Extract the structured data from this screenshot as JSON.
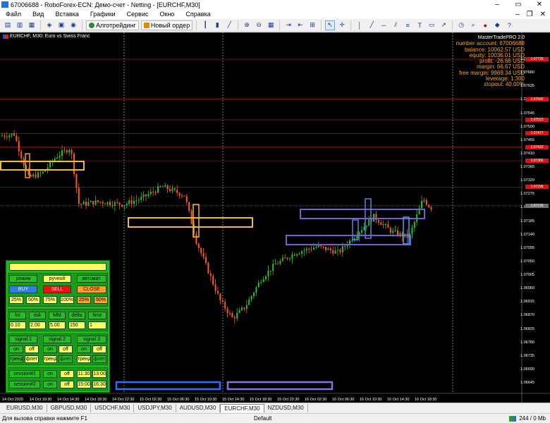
{
  "window": {
    "title": "67006688 - RoboForex-ECN: Демо-счет - Netting - [EURCHF,M30]",
    "min": "–",
    "max": "▭",
    "close": "✕"
  },
  "menu": [
    "Файл",
    "Вид",
    "Вставка",
    "Графики",
    "Сервис",
    "Окно",
    "Справка"
  ],
  "toolbar": {
    "algo_label": "Алготрейдинг",
    "order_label": "Новый ордер"
  },
  "chart": {
    "title": "EURCHF, M30:  Euro vs Swiss Franc"
  },
  "account": {
    "title": "MasterTradePRO 2.0",
    "lines": [
      "number account: 67006688",
      "balance: 10062.57 USD",
      "equity: 10036.01 USD",
      "profit: -26.66 USD",
      "margin: 66.67 USD",
      "free margin: 9969.34 USD",
      "leverage: 1:300",
      "stopout: 40.00%"
    ]
  },
  "price_scale": [
    "1.07725",
    "1.07680",
    "1.07635",
    "1.07590",
    "1.07545",
    "1.07500",
    "1.07455",
    "1.07410",
    "1.07365",
    "1.07320",
    "1.07275",
    "1.07230",
    "1.07185",
    "1.07140",
    "1.07095",
    "1.07050",
    "1.07005",
    "1.06960",
    "1.06915",
    "1.06870",
    "1.06825",
    "1.06780",
    "1.06735",
    "1.06690",
    "1.06645"
  ],
  "price_tags": [
    {
      "v": "1.07725",
      "c": "#e01010"
    },
    {
      "v": "1.07592",
      "c": "#e01010"
    },
    {
      "v": "1.07523",
      "c": "#e01010"
    },
    {
      "v": "1.07477",
      "c": "#e01010"
    },
    {
      "v": "1.07432",
      "c": "#e01010"
    },
    {
      "v": "1.07386",
      "c": "#e01010"
    },
    {
      "v": "1.07298",
      "c": "#e01010"
    },
    {
      "v": "1.07236",
      "c": "#707070"
    }
  ],
  "time_labels": [
    "14 Oct 2020",
    "14 Oct 10:30",
    "14 Oct 14:30",
    "14 Oct 18:30",
    "14 Oct 22:30",
    "15 Oct 02:30",
    "15 Oct 06:30",
    "15 Oct 10:30",
    "15 Oct 14:30",
    "15 Oct 18:30",
    "15 Oct 22:30",
    "16 Oct 02:30",
    "16 Oct 06:30",
    "16 Oct 10:30",
    "16 Oct 14:30",
    "16 Oct 18:30"
  ],
  "panel": {
    "mode": {
      "label": "режим",
      "manual": "ручной",
      "auto": "автомат."
    },
    "buy": "BUY",
    "sell": "SELL",
    "close": "CLOSE",
    "pct": [
      "25%",
      "50%",
      "75%",
      "100%",
      "25%",
      "50%"
    ],
    "headers": [
      "lot",
      "risk",
      "MM",
      "delta",
      "time"
    ],
    "values": [
      "0.10",
      "2.00",
      "5.00",
      "150",
      "1"
    ],
    "signals": [
      "signal 1",
      "signal 2",
      "signal 3"
    ],
    "on": "on",
    "off": "off",
    "trend": "тренд",
    "flat": "флет",
    "session1": "session#1",
    "session2": "session#2",
    "s1_from": "11:30",
    "s1_to": "13:00",
    "s2_from": "15:00",
    "s2_to": "16:30"
  },
  "tabs": [
    "EURUSD,M30",
    "GBPUSD,M30",
    "USDCHF,M30",
    "USDJPY,M30",
    "AUDUSD,M30",
    "EURCHF,M30",
    "NZDUSD,M30"
  ],
  "active_tab": "EURCHF,M30",
  "status": {
    "help": "Для вызова справки нажмите F1",
    "profile": "Default",
    "traffic": "244 / 0 Mb"
  }
}
